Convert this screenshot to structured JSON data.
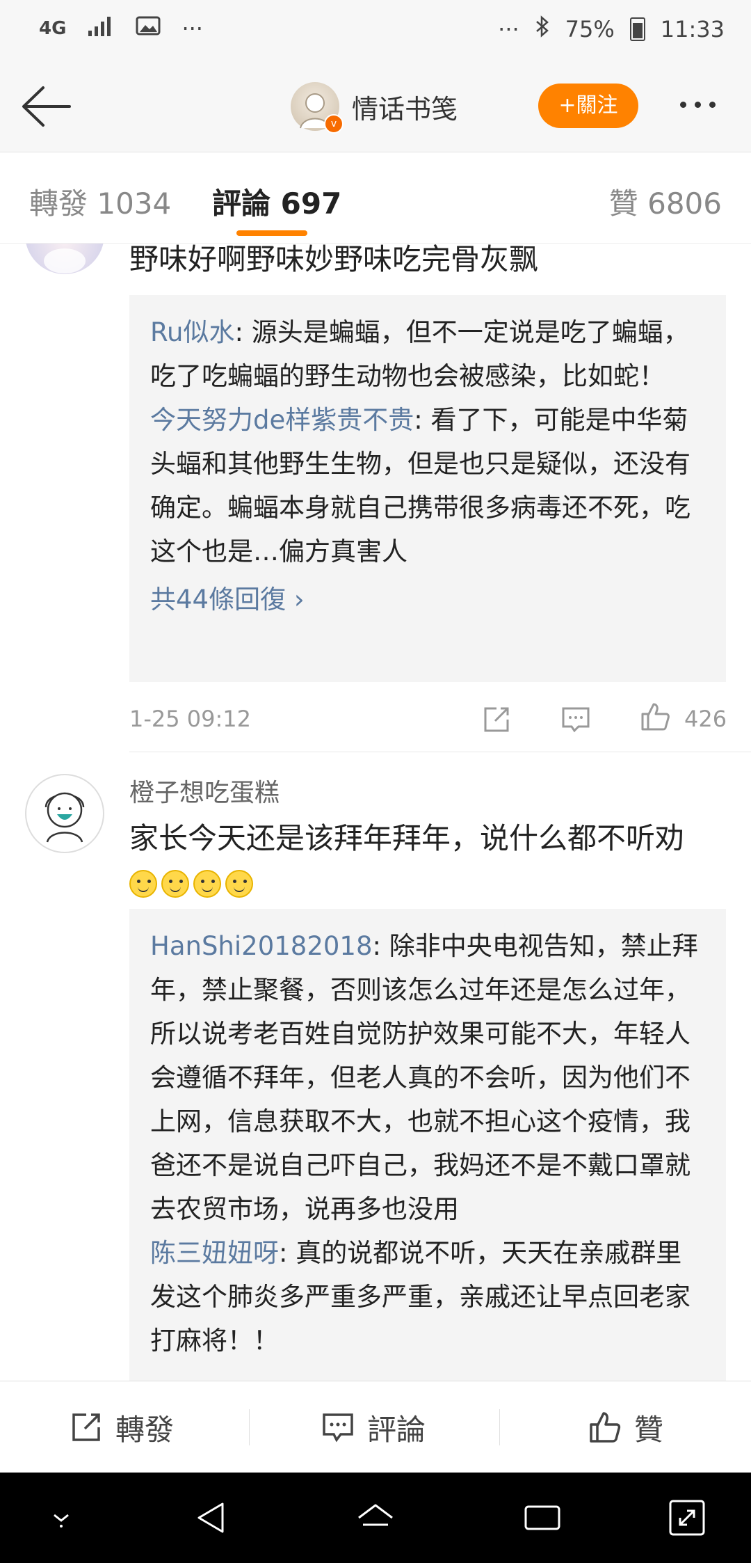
{
  "status_bar": {
    "network": "4G",
    "signal_icon": "signal-icon",
    "gallery_icon": "image-icon",
    "dots": "···",
    "dots_right": "···",
    "battery_percent": "75%",
    "time": "11:33"
  },
  "header": {
    "account_name": "情话书笺",
    "follow_label": "+關注"
  },
  "tabs": {
    "repost": "轉發 1034",
    "comment": "評論 697",
    "like": "贊 6806"
  },
  "comments": [
    {
      "text": "野味好啊野味妙野味吃完骨灰飘",
      "replies": [
        {
          "user": "Ru似水",
          "text": ": 源头是蝙蝠，但不一定说是吃了蝙蝠，吃了吃蝙蝠的野生动物也会被感染，比如蛇！"
        },
        {
          "user": "今天努力de样紫贵不贵",
          "text": ": 看了下，可能是中华菊头蝠和其他野生生物，但是也只是疑似，还没有确定。蝙蝠本身就自己携带很多病毒还不死，吃这个也是…偏方真害人"
        }
      ],
      "more_replies": "共44條回復 ›",
      "time": "1-25 09:12",
      "likes": "426"
    },
    {
      "username": "橙子想吃蛋糕",
      "text": "家长今天还是该拜年拜年，说什么都不听劝",
      "replies": [
        {
          "user": "HanShi20182018",
          "text": ": 除非中央电视告知，禁止拜年，禁止聚餐，否则该怎么过年还是怎么过年，所以说考老百姓自觉防护效果可能不大，年轻人会遵循不拜年，但老人真的不会听，因为他们不上网，信息获取不大，也就不担心这个疫情，我爸还不是说自己吓自己，我妈还不是不戴口罩就去农贸市场，说再多也没用"
        },
        {
          "user": "陈三妞妞呀",
          "text": ": 真的说都说不听，天天在亲戚群里发这个肺炎多严重多严重，亲戚还让早点回老家打麻将！！"
        }
      ]
    }
  ],
  "action_bar": {
    "repost": "轉發",
    "comment": "評論",
    "like": "贊"
  },
  "colors": {
    "accent": "#ff8200",
    "link": "#5b7aa0"
  }
}
